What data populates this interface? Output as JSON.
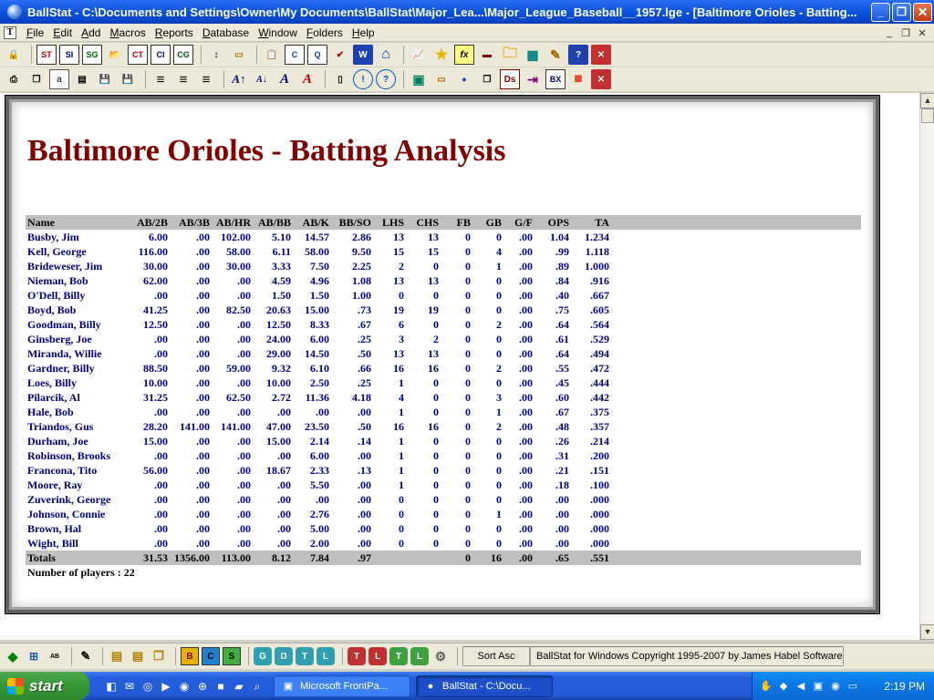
{
  "window": {
    "title": "BallStat -  C:\\Documents and Settings\\Owner\\My Documents\\BallStat\\Major_Lea...\\Major_League_Baseball__1957.lge  - [Baltimore Orioles - Batting...",
    "minimize_label": "_",
    "maximize_label": "❐",
    "close_label": "✕"
  },
  "menubar": {
    "mdi_icon": "T",
    "items": [
      {
        "mn": "F",
        "rest": "ile"
      },
      {
        "mn": "E",
        "rest": "dit"
      },
      {
        "mn": "A",
        "rest": "dd"
      },
      {
        "mn": "M",
        "rest": "acros"
      },
      {
        "mn": "R",
        "rest": "eports"
      },
      {
        "mn": "D",
        "rest": "atabase"
      },
      {
        "mn": "W",
        "rest": "indow"
      },
      {
        "mn": "F",
        "rest": "olders"
      },
      {
        "mn": "H",
        "rest": "elp"
      }
    ],
    "mdi_controls": [
      "_",
      "❐",
      "✕"
    ]
  },
  "toolbar1": {
    "open": "🔒",
    "st": "ST",
    "si": "SI",
    "sg": "SG",
    "folder": "📂",
    "ct": "CT",
    "ci": "CI",
    "cg": "CG",
    "sort": "↕",
    "ruler": "▭",
    "report": "📋",
    "c": "C",
    "q": "Q",
    "check": "✔",
    "w": "W",
    "home": "⌂",
    "chart": "📈",
    "star": "★",
    "fx": "fx",
    "fold2": "🗀",
    "grid": "▦",
    "pen": "✎",
    "help": "?",
    "close": "✕"
  },
  "toolbar2": {
    "print": "⎙",
    "copy": "❐",
    "doc": "a",
    "doc2": "▤",
    "save": "💾",
    "save2": "💾",
    "align_left": "≡",
    "align_center": "≡",
    "align_right": "≡",
    "font_up": "A↑",
    "font_down": "A↓",
    "font_a": "A",
    "font_red": "A",
    "page": "▯",
    "info": "!",
    "query": "?",
    "img": "▣",
    "dash": "▭",
    "dot": "●",
    "copy2": "❐",
    "ds": "Ds",
    "export": "⇥",
    "bx": "BX",
    "red": "■",
    "close": "✕"
  },
  "report": {
    "title": "Baltimore Orioles - Batting Analysis",
    "player_count_label": "Number of players : 22"
  },
  "table": {
    "columns": [
      "Name",
      "AB/2B",
      "AB/3B",
      "AB/HR",
      "AB/BB",
      "AB/K",
      "BB/SO",
      "LHS",
      "CHS",
      "FB",
      "GB",
      "G/F",
      "OPS",
      "TA"
    ],
    "rows": [
      [
        "Busby, Jim",
        "6.00",
        ".00",
        "102.00",
        "5.10",
        "14.57",
        "2.86",
        "13",
        "13",
        "0",
        "0",
        ".00",
        "1.04",
        "1.234"
      ],
      [
        "Kell, George",
        "116.00",
        ".00",
        "58.00",
        "6.11",
        "58.00",
        "9.50",
        "15",
        "15",
        "0",
        "4",
        ".00",
        ".99",
        "1.118"
      ],
      [
        "Brideweser, Jim",
        "30.00",
        ".00",
        "30.00",
        "3.33",
        "7.50",
        "2.25",
        "2",
        "0",
        "0",
        "1",
        ".00",
        ".89",
        "1.000"
      ],
      [
        "Nieman, Bob",
        "62.00",
        ".00",
        ".00",
        "4.59",
        "4.96",
        "1.08",
        "13",
        "13",
        "0",
        "0",
        ".00",
        ".84",
        ".916"
      ],
      [
        "O'Dell, Billy",
        ".00",
        ".00",
        ".00",
        "1.50",
        "1.50",
        "1.00",
        "0",
        "0",
        "0",
        "0",
        ".00",
        ".40",
        ".667"
      ],
      [
        "Boyd, Bob",
        "41.25",
        ".00",
        "82.50",
        "20.63",
        "15.00",
        ".73",
        "19",
        "19",
        "0",
        "0",
        ".00",
        ".75",
        ".605"
      ],
      [
        "Goodman, Billy",
        "12.50",
        ".00",
        ".00",
        "12.50",
        "8.33",
        ".67",
        "6",
        "0",
        "0",
        "2",
        ".00",
        ".64",
        ".564"
      ],
      [
        "Ginsberg, Joe",
        ".00",
        ".00",
        ".00",
        "24.00",
        "6.00",
        ".25",
        "3",
        "2",
        "0",
        "0",
        ".00",
        ".61",
        ".529"
      ],
      [
        "Miranda, Willie",
        ".00",
        ".00",
        ".00",
        "29.00",
        "14.50",
        ".50",
        "13",
        "13",
        "0",
        "0",
        ".00",
        ".64",
        ".494"
      ],
      [
        "Gardner, Billy",
        "88.50",
        ".00",
        "59.00",
        "9.32",
        "6.10",
        ".66",
        "16",
        "16",
        "0",
        "2",
        ".00",
        ".55",
        ".472"
      ],
      [
        "Loes, Billy",
        "10.00",
        ".00",
        ".00",
        "10.00",
        "2.50",
        ".25",
        "1",
        "0",
        "0",
        "0",
        ".00",
        ".45",
        ".444"
      ],
      [
        "Pilarcik, Al",
        "31.25",
        ".00",
        "62.50",
        "2.72",
        "11.36",
        "4.18",
        "4",
        "0",
        "0",
        "3",
        ".00",
        ".60",
        ".442"
      ],
      [
        "Hale, Bob",
        ".00",
        ".00",
        ".00",
        ".00",
        ".00",
        ".00",
        "1",
        "0",
        "0",
        "1",
        ".00",
        ".67",
        ".375"
      ],
      [
        "Triandos, Gus",
        "28.20",
        "141.00",
        "141.00",
        "47.00",
        "23.50",
        ".50",
        "16",
        "16",
        "0",
        "2",
        ".00",
        ".48",
        ".357"
      ],
      [
        "Durham, Joe",
        "15.00",
        ".00",
        ".00",
        "15.00",
        "2.14",
        ".14",
        "1",
        "0",
        "0",
        "0",
        ".00",
        ".26",
        ".214"
      ],
      [
        "Robinson, Brooks",
        ".00",
        ".00",
        ".00",
        ".00",
        "6.00",
        ".00",
        "1",
        "0",
        "0",
        "0",
        ".00",
        ".31",
        ".200"
      ],
      [
        "Francona, Tito",
        "56.00",
        ".00",
        ".00",
        "18.67",
        "2.33",
        ".13",
        "1",
        "0",
        "0",
        "0",
        ".00",
        ".21",
        ".151"
      ],
      [
        "Moore, Ray",
        ".00",
        ".00",
        ".00",
        ".00",
        "5.50",
        ".00",
        "1",
        "0",
        "0",
        "0",
        ".00",
        ".18",
        ".100"
      ],
      [
        "Zuverink, George",
        ".00",
        ".00",
        ".00",
        ".00",
        ".00",
        ".00",
        "0",
        "0",
        "0",
        "0",
        ".00",
        ".00",
        ".000"
      ],
      [
        "Johnson, Connie",
        ".00",
        ".00",
        ".00",
        ".00",
        "2.76",
        ".00",
        "0",
        "0",
        "0",
        "1",
        ".00",
        ".00",
        ".000"
      ],
      [
        "Brown, Hal",
        ".00",
        ".00",
        ".00",
        ".00",
        "5.00",
        ".00",
        "0",
        "0",
        "0",
        "0",
        ".00",
        ".00",
        ".000"
      ],
      [
        "Wight, Bill",
        ".00",
        ".00",
        ".00",
        ".00",
        "2.00",
        ".00",
        "0",
        "0",
        "0",
        "0",
        ".00",
        ".00",
        ".000"
      ]
    ],
    "totals": [
      "Totals",
      "31.53",
      "1356.00",
      "113.00",
      "8.12",
      "7.84",
      ".97",
      "",
      "",
      "0",
      "16",
      ".00",
      ".65",
      ".551"
    ]
  },
  "bottombar": {
    "b": "B",
    "c": "C",
    "s": "S",
    "g": "G",
    "d": "D",
    "t": "T",
    "l": "L",
    "t2": "T",
    "l2": "L",
    "t3": "T",
    "l3": "L",
    "sort_label": "Sort Asc",
    "status_text": "BallStat for Windows  Copyright 1995-2007 by James Habel Software"
  },
  "taskbar": {
    "start_label": "start",
    "tasks": [
      {
        "label": "Microsoft FrontPa...",
        "icon": "▣"
      },
      {
        "label": "BallStat - C:\\Docu...",
        "icon": "●"
      }
    ],
    "clock": "2:19 PM"
  },
  "colors": {
    "title_red": "#800000",
    "data_blue": "#000080",
    "header_gray": "#c0c0c0"
  }
}
